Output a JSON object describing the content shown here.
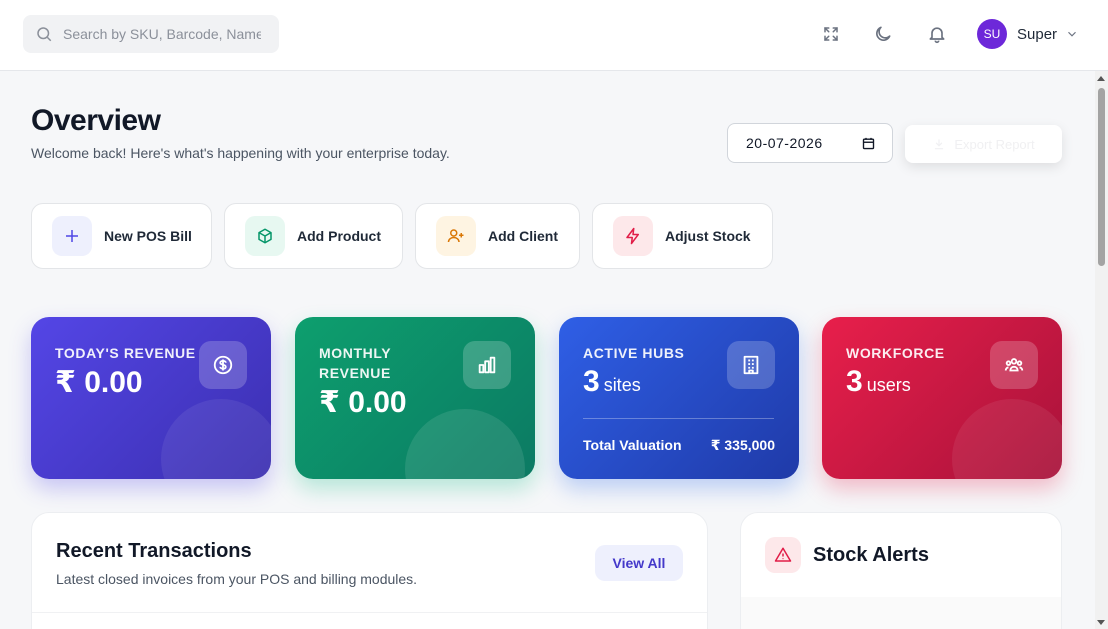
{
  "header": {
    "search": {
      "placeholder": "Search by SKU, Barcode, Name..."
    },
    "icons": [
      "fullscreen-icon",
      "moon-icon",
      "bell-icon"
    ],
    "user": {
      "initials": "SU",
      "name": "Super"
    }
  },
  "page": {
    "title": "Overview",
    "subtitle": "Welcome back! Here's what's happening with your enterprise today.",
    "date": "20-07-2026",
    "export_label": "Export Report"
  },
  "quick_actions": [
    {
      "label": "New POS Bill",
      "icon": "plus-icon",
      "color": "#4f46e5",
      "bg": "#eef0fd"
    },
    {
      "label": "Add Product",
      "icon": "box-icon",
      "color": "#059669",
      "bg": "#e7f8f1"
    },
    {
      "label": "Add Client",
      "icon": "user-plus-icon",
      "color": "#d97706",
      "bg": "#fef4e2"
    },
    {
      "label": "Adjust Stock",
      "icon": "bolt-icon",
      "color": "#e11d48",
      "bg": "#fde8ea"
    }
  ],
  "stats": {
    "today_revenue": {
      "label": "TODAY'S REVENUE",
      "value": "₹ 0.00"
    },
    "monthly_revenue": {
      "label_line1": "MONTHLY",
      "label_line2": "REVENUE",
      "value": "₹ 0.00"
    },
    "active_hubs": {
      "label": "ACTIVE HUBS",
      "value": "3",
      "unit": "sites",
      "foot_label": "Total Valuation",
      "foot_value": "₹ 335,000"
    },
    "workforce": {
      "label": "WORKFORCE",
      "value": "3",
      "unit": "users"
    }
  },
  "transactions": {
    "title": "Recent Transactions",
    "subtitle": "Latest closed invoices from your POS and billing modules.",
    "view_all": "View All"
  },
  "stock_alerts": {
    "title": "Stock Alerts"
  },
  "colors": {
    "accent": "#4f46e5",
    "today_revenue_gradient": [
      "#5446e6",
      "#3b2fb0"
    ],
    "monthly_revenue_gradient": [
      "#0d9f6e",
      "#0c7a63"
    ],
    "active_hubs_gradient": [
      "#2f5fe6",
      "#1f3aa8"
    ],
    "workforce_gradient": [
      "#e81f4b",
      "#a8123a"
    ]
  }
}
